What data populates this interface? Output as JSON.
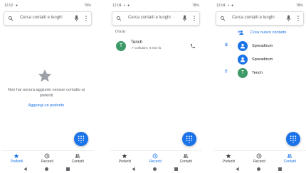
{
  "colors": {
    "accent": "#1a73e8",
    "avatar_green": "#3d9a67",
    "avatar_blue": "#1a73e8"
  },
  "screens": [
    {
      "status": {
        "time": "12:02",
        "battery": "79%"
      },
      "search_placeholder": "Cerca contatti e luoghi",
      "empty_text": "Non hai ancora aggiunto nessun contatto ai preferiti",
      "add_favorite": "Aggiungi un preferito",
      "tabs": [
        {
          "label": "Preferiti",
          "icon": "star-icon",
          "active": true
        },
        {
          "label": "Recenti",
          "icon": "clock-icon",
          "active": false
        },
        {
          "label": "Contatti",
          "icon": "people-icon",
          "active": false
        }
      ]
    },
    {
      "status": {
        "time": "12:04",
        "battery": "78%"
      },
      "search_placeholder": "Cerca contatti e luoghi",
      "section_label": "OGGI",
      "recent": {
        "initial": "T",
        "name": "Tench",
        "detail": "Cellulare, 6 min fa"
      },
      "tabs": [
        {
          "label": "Preferiti",
          "icon": "star-icon",
          "active": false
        },
        {
          "label": "Recenti",
          "icon": "clock-icon",
          "active": true
        },
        {
          "label": "Contatti",
          "icon": "people-icon",
          "active": false
        }
      ]
    },
    {
      "status": {
        "time": "12:04",
        "battery": "78%"
      },
      "search_placeholder": "Cerca contatti e luoghi",
      "create_contact": "Crea nuovo contatto",
      "contacts": [
        {
          "letter": "S",
          "name": "Spreadtrum",
          "avatar": "person-icon"
        },
        {
          "letter": "",
          "name": "Spreadtrum",
          "avatar": "person-icon"
        },
        {
          "letter": "T",
          "name": "Tench",
          "avatar_initial": "T"
        }
      ],
      "tabs": [
        {
          "label": "Preferiti",
          "icon": "star-icon",
          "active": false
        },
        {
          "label": "Recenti",
          "icon": "clock-icon",
          "active": false
        },
        {
          "label": "Contatti",
          "icon": "people-icon",
          "active": true
        }
      ]
    }
  ]
}
